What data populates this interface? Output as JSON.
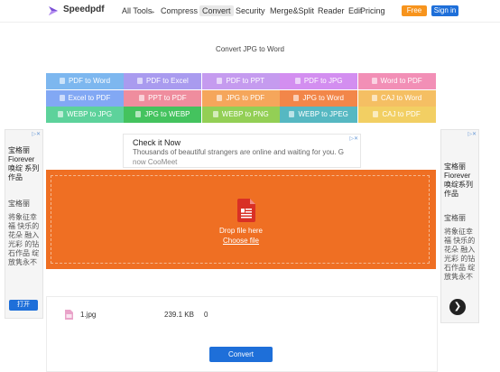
{
  "header": {
    "brand": "Speedpdf",
    "nav": [
      "All Tools",
      "Compress",
      "Convert",
      "Security",
      "Merge&Split",
      "Reader",
      "Edit",
      "Pricing"
    ],
    "free_label": "Free",
    "signin_label": "Sign in"
  },
  "page_title": "Convert JPG to Word",
  "tools": [
    {
      "label": "PDF to Word",
      "color": "#7db7ef"
    },
    {
      "label": "PDF to Excel",
      "color": "#a99bef"
    },
    {
      "label": "PDF to PPT",
      "color": "#c59bef"
    },
    {
      "label": "PDF to JPG",
      "color": "#d38ef0"
    },
    {
      "label": "Word to PDF",
      "color": "#f28fb6"
    },
    {
      "label": "Excel to PDF",
      "color": "#82a8f4"
    },
    {
      "label": "PPT to PDF",
      "color": "#ef8d9e"
    },
    {
      "label": "JPG to PDF",
      "color": "#f5a65b"
    },
    {
      "label": "JPG to Word",
      "color": "#f28649"
    },
    {
      "label": "CAJ to Word",
      "color": "#f5bf63"
    },
    {
      "label": "WEBP to JPG",
      "color": "#5dd29b"
    },
    {
      "label": "JPG to WEBP",
      "color": "#44c35e"
    },
    {
      "label": "WEBP to PNG",
      "color": "#93cf55"
    },
    {
      "label": "WEBP to JPEG",
      "color": "#56b8c2"
    },
    {
      "label": "CAJ to PDF",
      "color": "#f2cf63"
    }
  ],
  "ad_left": {
    "tag": "▷✕",
    "title": "宝格丽 Fiorever 唤绽 系列 作品",
    "subtitle": "宝格丽",
    "body": "将象征幸福 快乐的花朵 融入光彩 的钻石作品 绽放隽永不 的璀璨光芒",
    "open_label": "打开"
  },
  "ad_right": {
    "tag": "▷✕",
    "title": "宝格丽 Fiorever 唤绽系列 作品",
    "subtitle": "宝格丽",
    "body": "将象征幸福 快乐的花朵 融入光彩 的钻石作品 绽放隽永不 的璀璨光芒",
    "arrow": "❯"
  },
  "check_ad": {
    "title": "Check it Now",
    "desc": "Thousands of beautiful strangers are online and waiting for you. G",
    "brand": "now CooMeet",
    "tag": "▷✕"
  },
  "dropzone": {
    "text": "Drop file here",
    "choose": "Choose file"
  },
  "files": [
    {
      "name": "1.jpg",
      "size": "239.1 KB",
      "status": "0"
    }
  ],
  "convert_label": "Convert"
}
